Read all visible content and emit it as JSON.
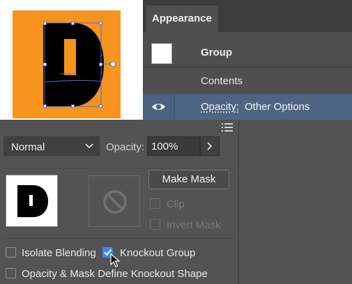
{
  "canvas": {
    "artboard_color": "#f7941d",
    "artwork_letter": "D"
  },
  "appearance_panel": {
    "tab_label": "Appearance",
    "group_label": "Group",
    "contents_label": "Contents",
    "opacity_link": "Opacity:",
    "opacity_value": "Other Options",
    "eye_icon": "eye-icon",
    "highlight_color": "#4d6582"
  },
  "transparency_panel": {
    "blend_mode": "Normal",
    "opacity_label": "Opacity:",
    "opacity_value": "100%",
    "make_mask_label": "Make Mask",
    "clip_label": "Clip",
    "invert_mask_label": "Invert Mask",
    "isolate_blending_label": "Isolate Blending",
    "knockout_group_label": "Knockout Group",
    "opacity_mask_knockout_label": "Opacity & Mask Define Knockout Shape",
    "thumbnail_letter": "D",
    "checkbox_accent": "#3d85ef"
  }
}
